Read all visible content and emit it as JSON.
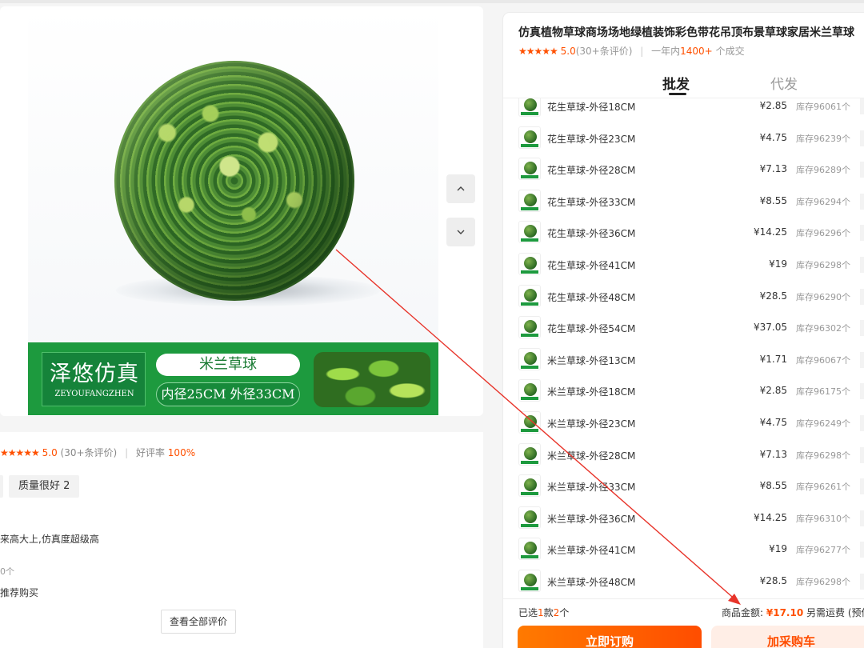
{
  "gallery": {
    "banner": {
      "brand_cn": "泽悠仿真",
      "brand_en": "ZEYOUFANGZHEN",
      "product_name": "米兰草球",
      "dimensions": "内径25CM 外径33CM"
    },
    "arrow_up": "⌃",
    "arrow_down": "⌄"
  },
  "reviews": {
    "stars": "★★★★★",
    "score": "5.0",
    "count_text": "(30+条评价)",
    "sep": "|",
    "good_rate_label": "好评率",
    "good_rate_value": "100%",
    "tag": "质量很好 2",
    "snippet": "来高大上,仿真度超级高",
    "qty_snippet": "0个",
    "recommend_snippet": "推荐购买",
    "all_reviews_button": "查看全部评价"
  },
  "product": {
    "title": "仿真植物草球商场场地绿植装饰彩色带花吊顶布景草球家居米兰草球",
    "stars": "★★★★★",
    "score": "5.0",
    "review_count": "(30+条评价)",
    "sep": "|",
    "sales_prefix": "一年内",
    "sales_number": "1400+",
    "sales_suffix": "个成交"
  },
  "tabs": [
    {
      "label": "批发",
      "active": true
    },
    {
      "label": "代发",
      "active": false
    }
  ],
  "skus": [
    {
      "name": "花生草球-外径18CM",
      "price": "¥2.85",
      "stock": "库存96061个"
    },
    {
      "name": "花生草球-外径23CM",
      "price": "¥4.75",
      "stock": "库存96239个"
    },
    {
      "name": "花生草球-外径28CM",
      "price": "¥7.13",
      "stock": "库存96289个"
    },
    {
      "name": "花生草球-外径33CM",
      "price": "¥8.55",
      "stock": "库存96294个"
    },
    {
      "name": "花生草球-外径36CM",
      "price": "¥14.25",
      "stock": "库存96296个"
    },
    {
      "name": "花生草球-外径41CM",
      "price": "¥19",
      "stock": "库存96298个"
    },
    {
      "name": "花生草球-外径48CM",
      "price": "¥28.5",
      "stock": "库存96290个"
    },
    {
      "name": "花生草球-外径54CM",
      "price": "¥37.05",
      "stock": "库存96302个"
    },
    {
      "name": "米兰草球-外径13CM",
      "price": "¥1.71",
      "stock": "库存96067个"
    },
    {
      "name": "米兰草球-外径18CM",
      "price": "¥2.85",
      "stock": "库存96175个"
    },
    {
      "name": "米兰草球-外径23CM",
      "price": "¥4.75",
      "stock": "库存96249个"
    },
    {
      "name": "米兰草球-外径28CM",
      "price": "¥7.13",
      "stock": "库存96298个"
    },
    {
      "name": "米兰草球-外径33CM",
      "price": "¥8.55",
      "stock": "库存96261个"
    },
    {
      "name": "米兰草球-外径36CM",
      "price": "¥14.25",
      "stock": "库存96310个"
    },
    {
      "name": "米兰草球-外径41CM",
      "price": "¥19",
      "stock": "库存96277个"
    },
    {
      "name": "米兰草球-外径48CM",
      "price": "¥28.5",
      "stock": "库存96298个"
    }
  ],
  "summary": {
    "selected_prefix": "已选",
    "selected_kinds": "1",
    "selected_mid": "款",
    "selected_items": "2",
    "selected_suffix": "个",
    "amount_label": "商品金额:",
    "amount_value": "¥17.10",
    "shipping_note": "另需运费 (预估"
  },
  "actions": {
    "order": "立即订购",
    "cart": "加采购车"
  },
  "colors": {
    "accent": "#ff5000",
    "annotation_arrow": "#e8342a",
    "banner_green": "#1d9a3e"
  }
}
